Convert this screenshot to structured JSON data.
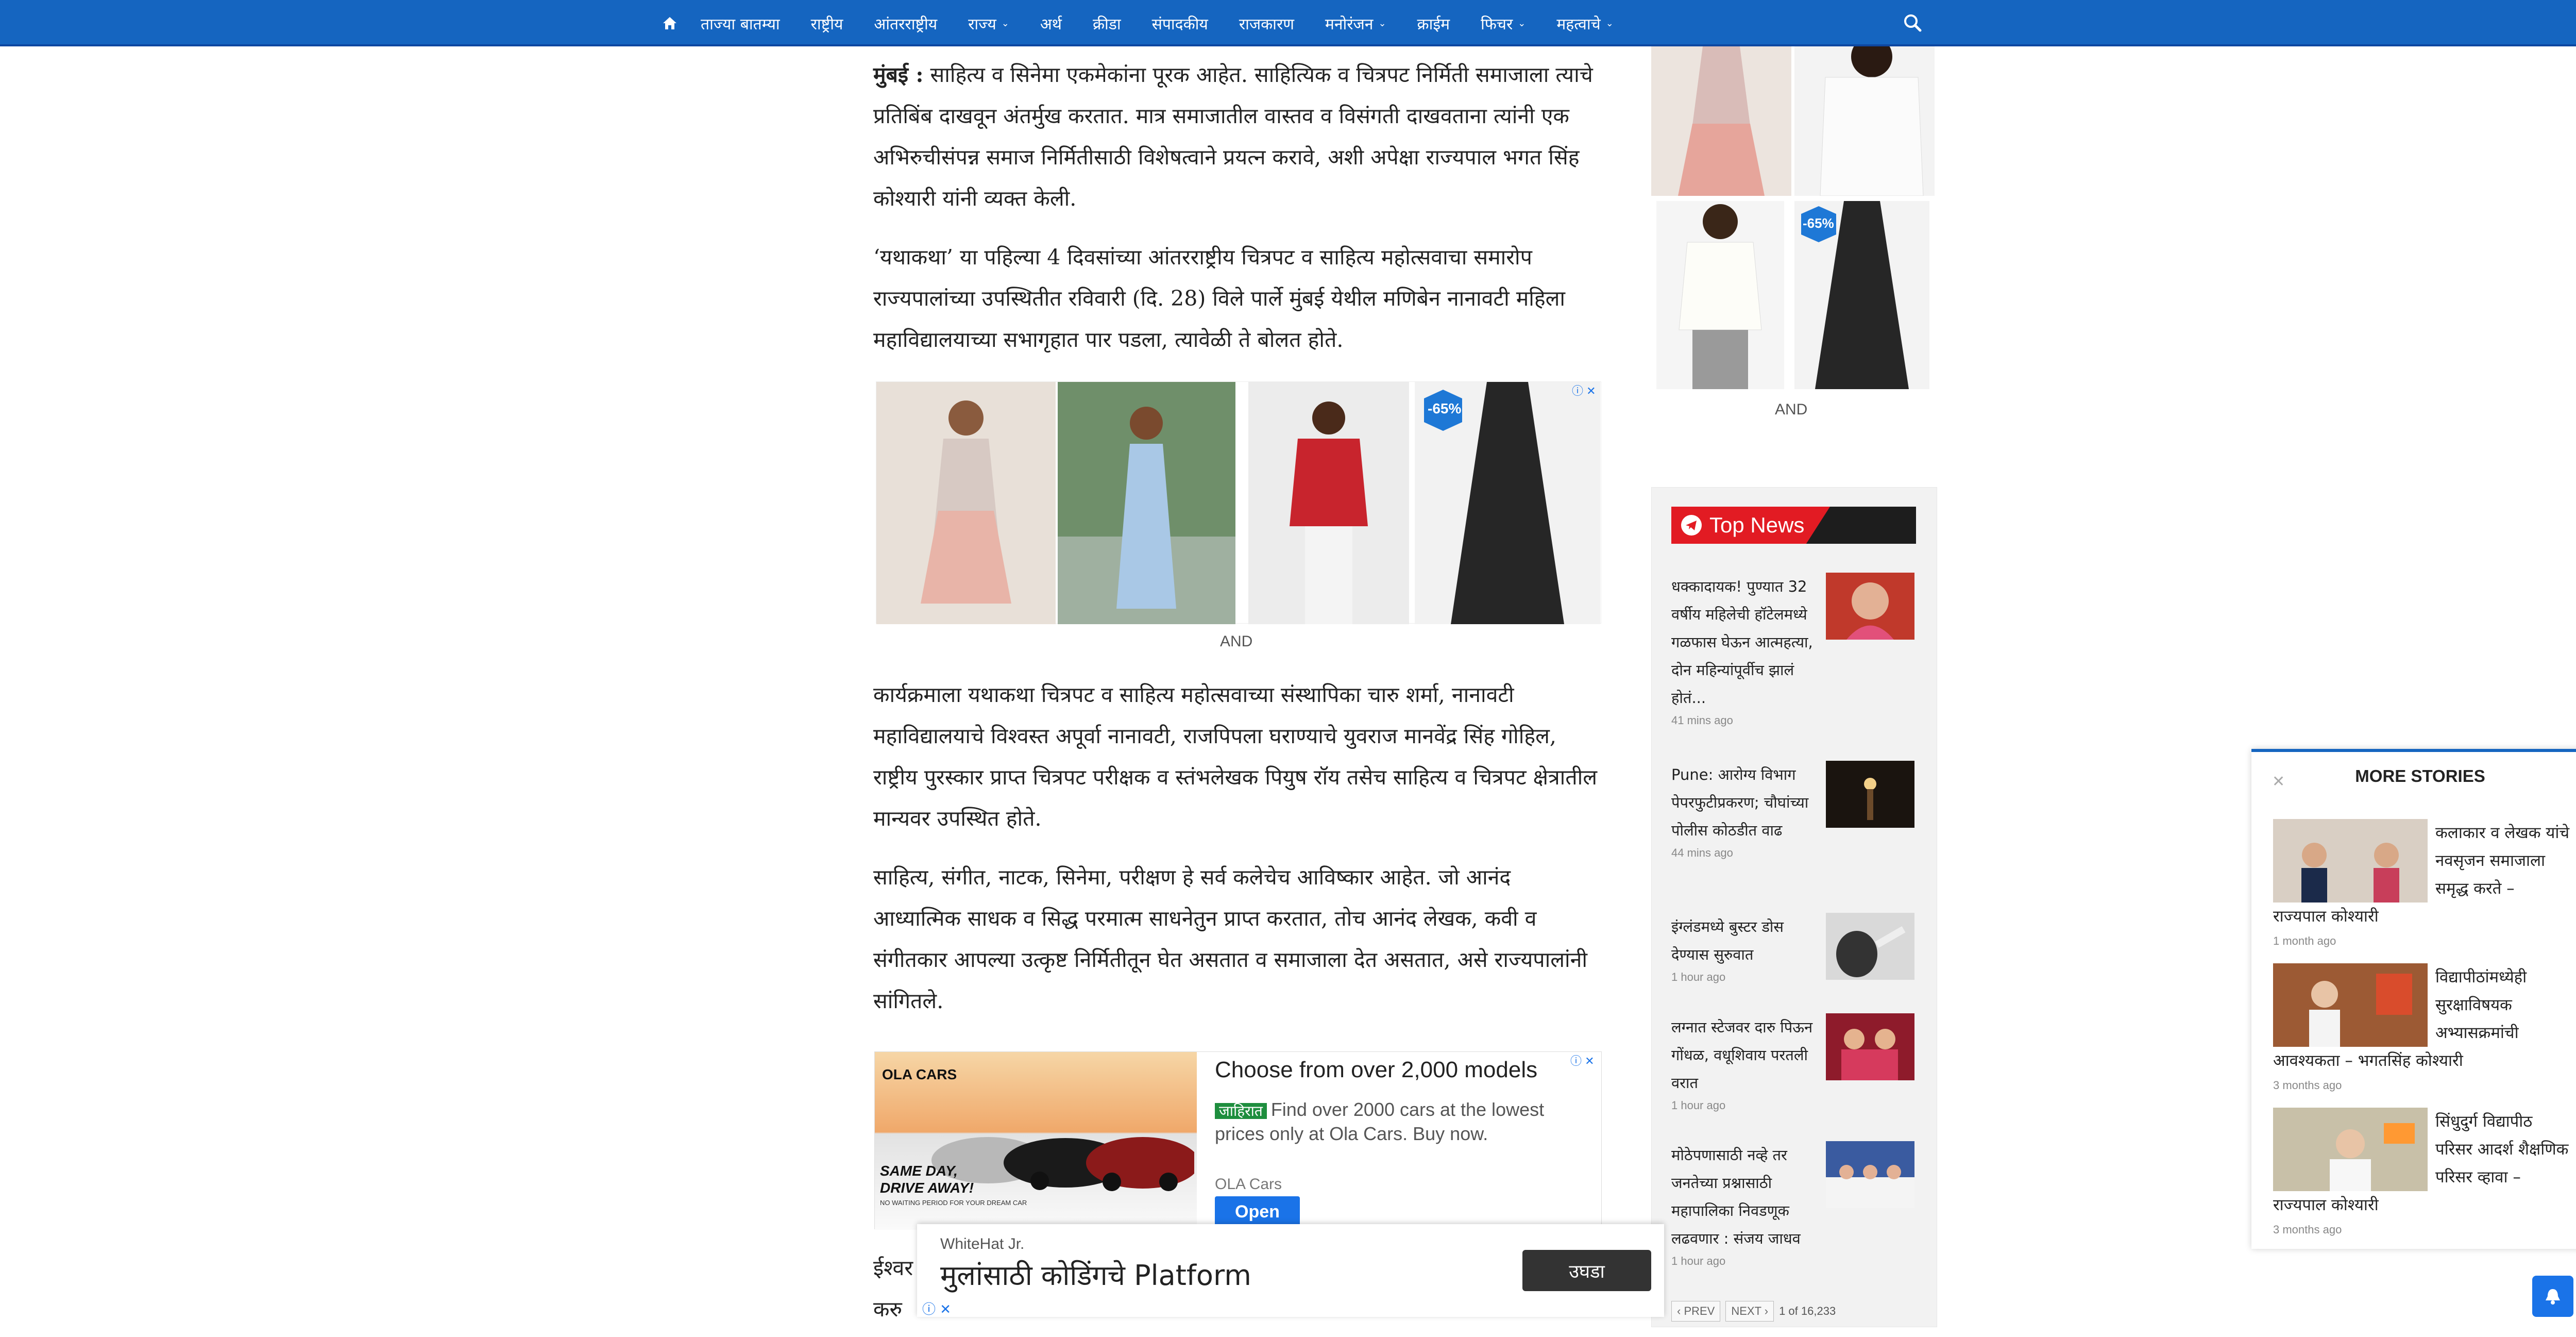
{
  "nav": {
    "items": [
      {
        "label": "ताज्या बातम्या",
        "caret": false
      },
      {
        "label": "राष्ट्रीय",
        "caret": false
      },
      {
        "label": "आंतरराष्ट्रीय",
        "caret": false
      },
      {
        "label": "राज्य",
        "caret": true
      },
      {
        "label": "अर्थ",
        "caret": false
      },
      {
        "label": "क्रीडा",
        "caret": false
      },
      {
        "label": "संपादकीय",
        "caret": false
      },
      {
        "label": "राजकारण",
        "caret": false
      },
      {
        "label": "मनोरंजन",
        "caret": true
      },
      {
        "label": "क्राईम",
        "caret": false
      },
      {
        "label": "फिचर",
        "caret": true
      },
      {
        "label": "महत्वाचे",
        "caret": true
      }
    ],
    "bg_color": "#1565c0"
  },
  "article": {
    "p1_lead": "मुंबई :",
    "p1": " साहित्य व सिनेमा एकमेकांना पूरक आहेत. साहित्यिक व चित्रपट निर्मिती समाजाला त्याचे प्रतिबिंब दाखवून अंतर्मुख करतात. मात्र समाजातील वास्तव व विसंगती दाखवताना त्यांनी एक अभिरुचीसंपन्न समाज निर्मितीसाठी विशेषत्वाने प्रयत्न करावे, अशी अपेक्षा राज्यपाल भगत सिंह कोश्यारी यांनी व्यक्त केली.",
    "p2": "‘यथाकथा’ या पहिल्या 4 दिवसांच्या आंतरराष्ट्रीय चित्रपट व साहित्य महोत्सवाचा समारोप राज्यपालांच्या उपस्थितीत रविवारी (दि. 28) विले पार्ले मुंबई येथील मणिबेन नानावटी महिला महाविद्यालयाच्या सभागृहात पार पडला, त्यावेळी ते बोलत होते.",
    "p3": "कार्यक्रमाला यथाकथा चित्रपट व साहित्य महोत्सवाच्या संस्थापिका चारु शर्मा, नानावटी महाविद्यालयाचे विश्वस्त अपूर्वा नानावटी, राजपिपला घराण्याचे युवराज मानवेंद्र सिंह गोहिल, राष्ट्रीय पुरस्कार प्राप्त चित्रपट परीक्षक व स्तंभलेखक पियुष रॉय तसेच साहित्य व चित्रपट क्षेत्रातील मान्यवर उपस्थित होते.",
    "p4": "साहित्य, संगीत, नाटक, सिनेमा, परीक्षण हे सर्व कलेचेच आविष्कार आहेत. जो आनंद आध्यात्मिक साधक व सिद्ध परमात्म साधनेतुन प्राप्त करतात, तोच आनंद लेखक, कवी व संगीतकार आपल्या उत्कृष्ट निर्मितीतून घेत असतात व समाजाला देत असतात, असे राज्यपालांनी सांगितले.",
    "tail1": "ईश्वर",
    "tail2": "करु"
  },
  "ads": {
    "gallery_label": "AND",
    "gallery_badge": "-65%",
    "side_label": "AND",
    "side_badge": "-65%",
    "ola": {
      "brand_logo": "OLA CARS",
      "img_slogan1": "SAME DAY,",
      "img_slogan2": "DRIVE AWAY!",
      "img_footnote": "NO WAITING PERIOD FOR YOUR DREAM CAR",
      "title": "Choose from over 2,000 models",
      "tag": "जाहिरात",
      "desc": "Find over 2000 cars at the lowest prices only at Ola Cars. Buy now.",
      "brand": "OLA Cars",
      "cta": "Open"
    },
    "sticky": {
      "brand": "WhiteHat Jr.",
      "headline": "मुलांसाठी कोडिंगचे Platform",
      "cta": "उघडा"
    }
  },
  "top_news": {
    "heading": "Top News",
    "items": [
      {
        "title": "धक्कादायक! पुण्यात 32 वर्षीय महिलेची हॉटेलमध्ये गळफास घेऊन आत्महत्या, दोन महिन्यांपूर्वीच झालं होतं...",
        "time": "41 mins ago"
      },
      {
        "title": "Pune: आरोग्य विभाग पेपरफुटीप्रकरण; चौघांच्या पोलीस कोठडीत वाढ",
        "time": "44 mins ago"
      },
      {
        "title": "इंग्लंडमध्ये बुस्टर डोस देण्यास सुरुवात",
        "time": "1 hour ago"
      },
      {
        "title": "लग्नात स्टेजवर दारु पिऊन गोंधळ, वधूशिवाय परतली वरात",
        "time": "1 hour ago"
      },
      {
        "title": "मोठेपणासाठी नव्हे तर जनतेच्या प्रश्नासाठी महापालिका निवडणूक लढवणार : संजय जाधव",
        "time": "1 hour ago"
      }
    ],
    "prev": "‹ PREV",
    "next": "NEXT ›",
    "count": "1 of 16,233"
  },
  "more_stories": {
    "heading": "MORE STORIES",
    "items": [
      {
        "title": "कलाकार व लेखक यांचे नवसृजन समाजाला समृद्ध करते – राज्यपाल कोश्यारी",
        "time": "1 month ago"
      },
      {
        "title": "विद्यापीठांमध्येही सुरक्षाविषयक अभ्यासक्रमांची आवश्यकता – भगतसिंह कोश्यारी",
        "time": "3 months ago"
      },
      {
        "title": "सिंधुदुर्ग विद्यापीठ परिसर आदर्श शैक्षणिक परिसर व्हावा – राज्यपाल कोश्यारी",
        "time": "3 months ago"
      }
    ]
  }
}
